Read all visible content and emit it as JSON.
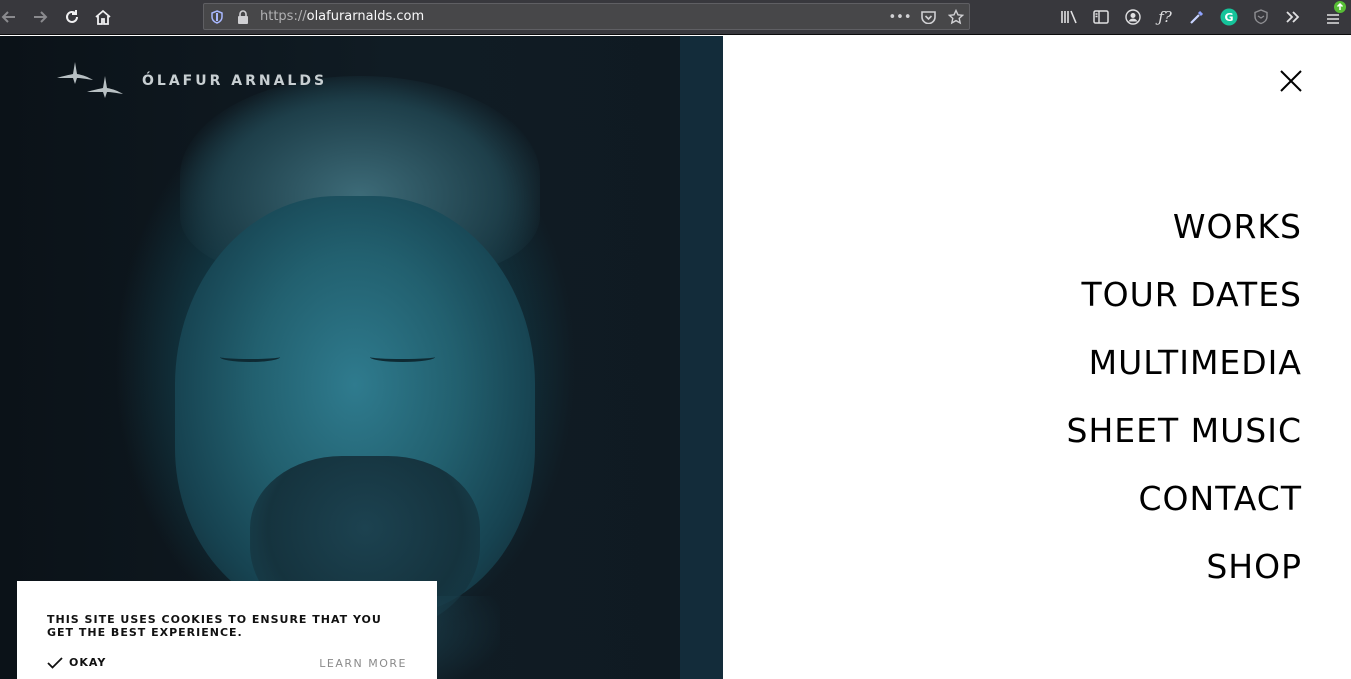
{
  "browser": {
    "url_scheme": "https://",
    "url_host": "olafurarnalds.com",
    "toolbar_icons": [
      "library-icon",
      "sidebar-icon",
      "account-icon",
      "font-finder-icon",
      "color-picker-icon",
      "grammarly-icon",
      "privacy-badger-icon",
      "overflow-icon",
      "menu-icon"
    ],
    "grammarly_color": "#15c39a"
  },
  "site": {
    "logo_text": "ÓLAFUR ARNALDS",
    "menu": {
      "items": [
        "WORKS",
        "TOUR DATES",
        "MULTIMEDIA",
        "SHEET MUSIC",
        "CONTACT",
        "SHOP"
      ]
    }
  },
  "cookie_banner": {
    "message": "THIS SITE USES COOKIES TO ENSURE THAT YOU GET THE BEST EXPERIENCE.",
    "okay_label": "OKAY",
    "learn_more_label": "LEARN MORE"
  }
}
